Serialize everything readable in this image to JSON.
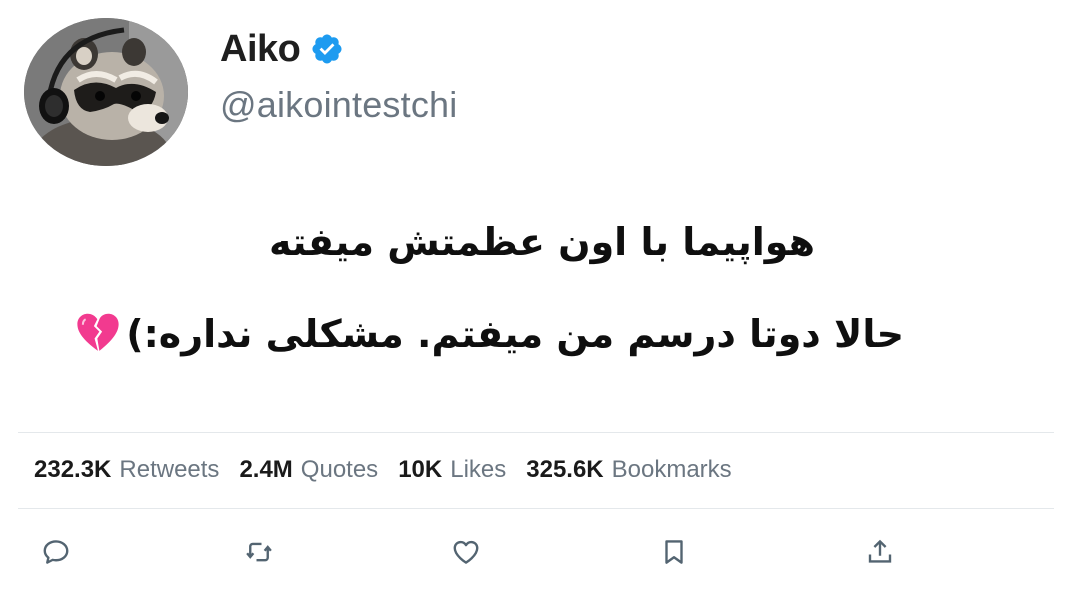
{
  "author": {
    "display_name": "Aiko",
    "handle": "@aikointestchi",
    "verified_icon": "verified-badge-icon",
    "avatar_icon": "raccoon-with-headphones-avatar"
  },
  "tweet": {
    "line1": "هواپیما با اون عظمتش میفته",
    "line2": "حالا دوتا درسم من میفتم. مشکلی نداره:)",
    "emoji_icon": "broken-heart-icon"
  },
  "stats": {
    "retweets_count": "232.3K",
    "retweets_label": "Retweets",
    "quotes_count": "2.4M",
    "quotes_label": "Quotes",
    "likes_count": "10K",
    "likes_label": "Likes",
    "bookmarks_count": "325.6K",
    "bookmarks_label": "Bookmarks"
  },
  "actions": {
    "reply": "reply-icon",
    "retweet": "retweet-icon",
    "like": "like-icon",
    "bookmark": "bookmark-icon",
    "share": "share-icon"
  },
  "colors": {
    "verified_blue": "#1d9bf0",
    "muted_text": "#6b7681",
    "primary_text": "#1a1a1a",
    "heart_pink": "#f23a8f"
  }
}
